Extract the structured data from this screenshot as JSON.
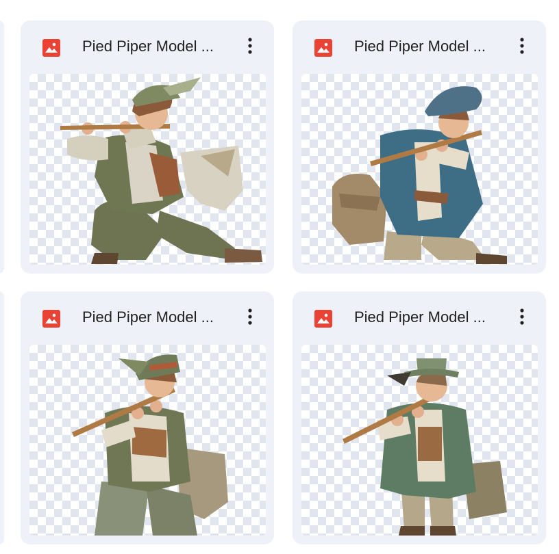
{
  "files": [
    {
      "name": "Pied Piper Model ...",
      "type": "image"
    },
    {
      "name": "Pied Piper Model ...",
      "type": "image"
    },
    {
      "name": "Pied Piper Model ...",
      "type": "image"
    },
    {
      "name": "Pied Piper Model ...",
      "type": "image"
    }
  ],
  "icons": {
    "file_type": "image-file-icon",
    "more": "more-vertical-icon"
  },
  "colors": {
    "card_bg": "#eef1f7",
    "image_icon_red": "#ea4335",
    "title_text": "#1f1f1f"
  }
}
